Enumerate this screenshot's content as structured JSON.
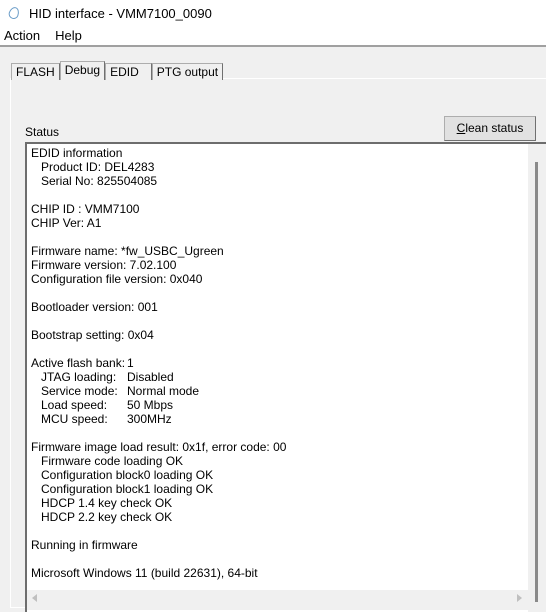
{
  "window": {
    "title": "HID interface - VMM7100_0090",
    "icon": "droplet-icon"
  },
  "menu": [
    {
      "label": "Action"
    },
    {
      "label": "Help"
    }
  ],
  "tabs": [
    {
      "label": "FLASH"
    },
    {
      "label": "Debug",
      "active": true
    },
    {
      "label": "EDID"
    },
    {
      "label": "PTG output"
    }
  ],
  "status": {
    "label": "Status",
    "clean_button": {
      "mnemonic": "C",
      "rest": "lean status"
    },
    "lines": [
      {
        "text": "EDID information"
      },
      {
        "text": "Product ID: DEL4283",
        "indent": true
      },
      {
        "text": "Serial No: 825504085",
        "indent": true
      },
      {
        "text": ""
      },
      {
        "text": "CHIP ID : VMM7100"
      },
      {
        "text": "CHIP Ver: A1"
      },
      {
        "text": ""
      },
      {
        "text": "Firmware name: *fw_USBC_Ugreen"
      },
      {
        "text": "Firmware version: 7.02.100"
      },
      {
        "text": "Configuration file version: 0x040"
      },
      {
        "text": ""
      },
      {
        "text": "Bootloader version: 001"
      },
      {
        "text": ""
      },
      {
        "text": "Bootstrap setting: 0x04"
      },
      {
        "text": ""
      },
      {
        "label": "Active flash bank:",
        "value": "1"
      },
      {
        "label": "JTAG loading:",
        "value": "Disabled",
        "indent": true
      },
      {
        "label": "Service mode:",
        "value": "Normal mode",
        "indent": true
      },
      {
        "label": "Load speed:",
        "value": "50 Mbps",
        "indent": true
      },
      {
        "label": "MCU speed:",
        "value": "300MHz",
        "indent": true
      },
      {
        "text": ""
      },
      {
        "text": "Firmware image load result: 0x1f, error code: 00"
      },
      {
        "text": "Firmware code loading OK",
        "indent": true
      },
      {
        "text": "Configuration block0 loading OK",
        "indent": true
      },
      {
        "text": "Configuration block1 loading OK",
        "indent": true
      },
      {
        "text": "HDCP 1.4 key check OK",
        "indent": true
      },
      {
        "text": "HDCP 2.2 key check OK",
        "indent": true
      },
      {
        "text": ""
      },
      {
        "text": "Running in firmware"
      },
      {
        "text": ""
      },
      {
        "text": "Microsoft Windows 11 (build 22631), 64-bit"
      }
    ]
  }
}
